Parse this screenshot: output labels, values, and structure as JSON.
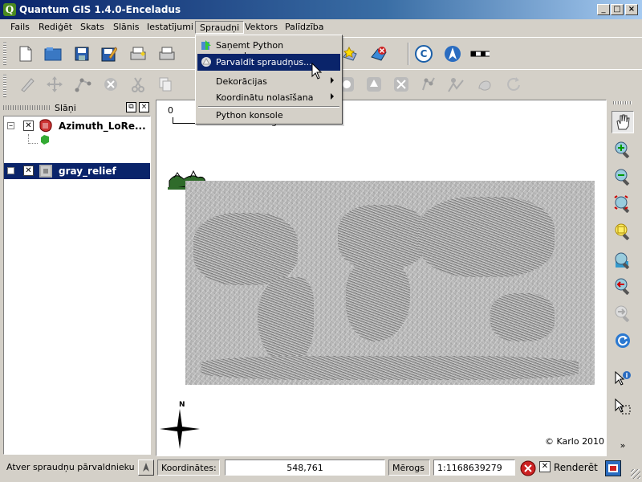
{
  "window": {
    "title": "Quantum GIS 1.4.0-Enceladus",
    "app_icon": "Q",
    "minimize": "_",
    "maximize": "□",
    "close": "×"
  },
  "menubar": {
    "items": [
      "Fails",
      "Rediģēt",
      "Skats",
      "Slānis",
      "Iestatījumi",
      "Spraudņi",
      "Vektors",
      "Palīdzība"
    ]
  },
  "plugins_menu": {
    "items": [
      {
        "label": "Saņemt Python spraudņus...",
        "icon": "python-plugin-download-icon"
      },
      {
        "label": "Parvaldīt spraudņus...",
        "icon": "plugin-manager-icon"
      },
      {
        "label": "Dekorācijas",
        "submenu": true
      },
      {
        "label": "Koordinātu nolasīšana",
        "submenu": true
      },
      {
        "label": "Python konsole"
      }
    ]
  },
  "layers": {
    "title": "Slāņi",
    "items": [
      {
        "name": "Azimuth_LoRe...",
        "expand": "−",
        "checked": "✕",
        "icon": "vector-layer-icon"
      },
      {
        "name": "gray_relief",
        "expand": "−",
        "checked": "✕",
        "icon": "raster-layer-icon"
      }
    ]
  },
  "map": {
    "scalebar_label": "0",
    "scalebar_unit": "grādi",
    "copyright": "© Karlo 2010",
    "north_label": "N"
  },
  "status": {
    "message": "Atver spraudņu pārvaldnieku",
    "coords_label": "Koordinātes:",
    "coords_value": "548,761",
    "scale_label": "Mērogs",
    "scale_value": "1:1168639279",
    "render_label": "Renderēt",
    "render_checked": "✕"
  },
  "colors": {
    "titlebar_start": "#0a246a",
    "selection": "#0a246a",
    "chrome": "#d4d0c8"
  }
}
